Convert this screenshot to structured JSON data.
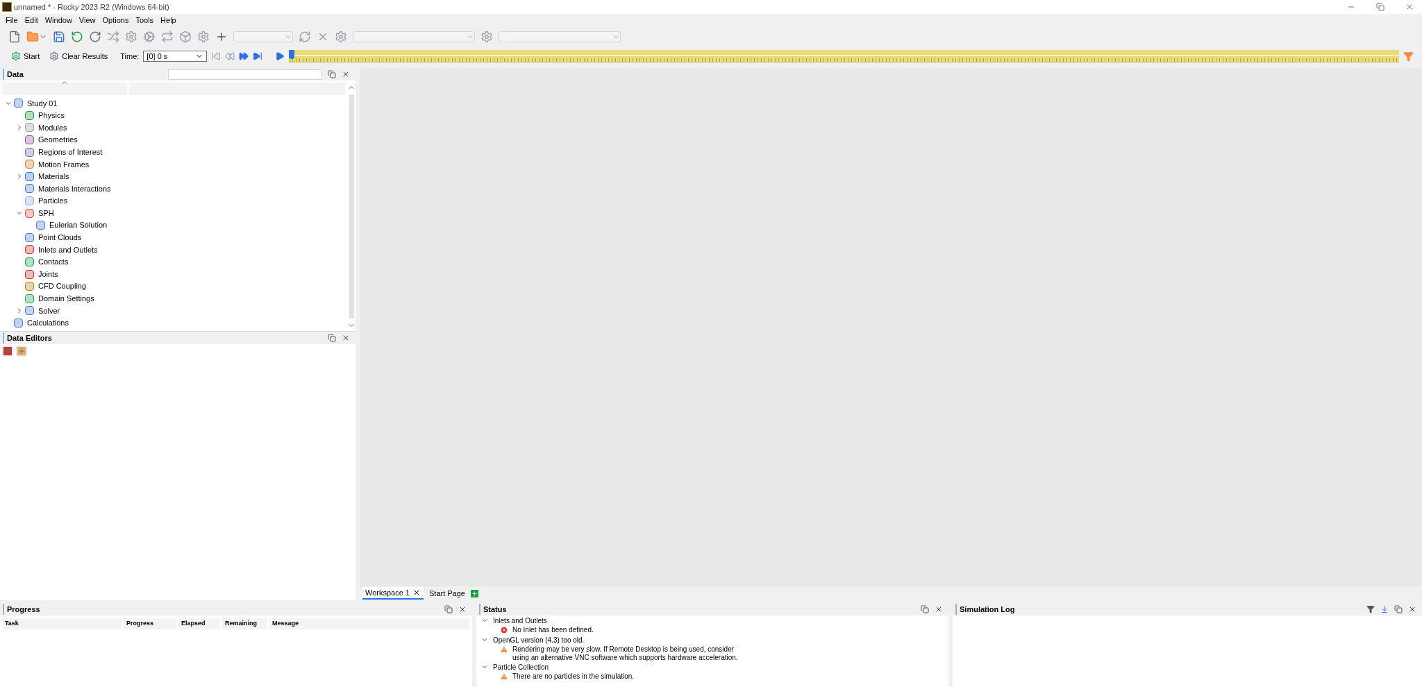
{
  "window": {
    "title": "unnamed * - Rocky 2023 R2 (Windows 64-bit)"
  },
  "menu": [
    "File",
    "Edit",
    "Window",
    "View",
    "Options",
    "Tools",
    "Help"
  ],
  "run_bar": {
    "start": "Start",
    "clear": "Clear Results",
    "time_label": "Time:",
    "time_value": "[0] 0 s",
    "timeline": {
      "level": 0
    }
  },
  "data_panel": {
    "title": "Data",
    "tree": [
      {
        "label": "Study 01",
        "expanded": true,
        "children": [
          {
            "label": "Physics"
          },
          {
            "label": "Modules",
            "expanded": false
          },
          {
            "label": "Geometries"
          },
          {
            "label": "Regions of Interest"
          },
          {
            "label": "Motion Frames"
          },
          {
            "label": "Materials",
            "expanded": false
          },
          {
            "label": "Materials Interactions"
          },
          {
            "label": "Particles"
          },
          {
            "label": "SPH",
            "expanded": true,
            "children": [
              {
                "label": "Eulerian Solution"
              }
            ]
          },
          {
            "label": "Point Clouds"
          },
          {
            "label": "Inlets and Outlets"
          },
          {
            "label": "Contacts"
          },
          {
            "label": "Joints"
          },
          {
            "label": "CFD Coupling"
          },
          {
            "label": "Domain Settings"
          },
          {
            "label": "Solver",
            "expanded": false
          }
        ]
      },
      {
        "label": "Calculations"
      }
    ]
  },
  "data_editors": {
    "title": "Data Editors"
  },
  "workspace_tabs": [
    {
      "label": "Workspace 1",
      "selected": true
    },
    {
      "label": "Start Page",
      "selected": false
    }
  ],
  "progress": {
    "title": "Progress",
    "columns": [
      "Task",
      "Progress",
      "Elapsed",
      "Remaining",
      "Message"
    ]
  },
  "status": {
    "title": "Status",
    "groups": [
      {
        "label": "Inlets and Outlets",
        "expanded": true,
        "messages": [
          {
            "kind": "error",
            "text": "No Inlet has been defined."
          }
        ]
      },
      {
        "label": "OpenGL version (4.3) too old.",
        "expanded": true,
        "messages": [
          {
            "kind": "warning",
            "text": "Rendering may be very slow. If Remote Desktop is being used, consider using an alternative VNC software which supports hardware acceleration."
          }
        ]
      },
      {
        "label": "Particle Collection",
        "expanded": true,
        "messages": [
          {
            "kind": "warning",
            "text": "There are no particles in the simulation."
          }
        ]
      }
    ]
  },
  "simulation_log": {
    "title": "Simulation Log"
  }
}
